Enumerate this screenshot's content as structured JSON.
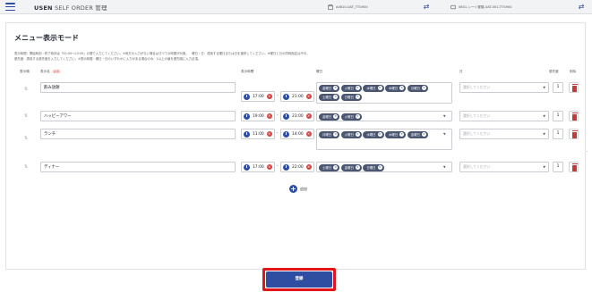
{
  "topbar": {
    "brand": "USEN",
    "brand_sub": "SELF ORDER 管理",
    "store": "A4810-UAT_TTG900",
    "device": "0801-シート冒険-UAT-001-TTG900"
  },
  "page": {
    "title": "メニュー表示モード",
    "note1": "表示時間：開始時刻・終了時刻は「00:00〜23:59」の間で入力してください。※両方の入力がない場合はすべての時間が対象。　曜日・日：適用する曜日または日を選択してください。※曜日と日の同時指定は不可。",
    "note2": "優先度：適用する優先度を入力してください。※表示時間・曜日・日のいずれかに入力がある場合のみ、1以上の値を優先順に入力必須。"
  },
  "columns": {
    "order": "表示順",
    "name": "表示名",
    "required": "必須",
    "time": "表示時間",
    "days": "曜日",
    "date": "日",
    "priority": "優先度",
    "delete": "削除"
  },
  "rows": [
    {
      "name": "飲み放題",
      "start": "17:00",
      "end": "21:00",
      "days": [
        "金曜日",
        "火曜日",
        "水曜日",
        "木曜日",
        "月曜日",
        "土曜日",
        "日曜日"
      ],
      "date_placeholder": "選択してください",
      "priority": "1"
    },
    {
      "name": "ハッピーアワー",
      "start": "19:00",
      "end": "23:00",
      "days": [
        "金曜日",
        "火曜日"
      ],
      "date_placeholder": "選択してください",
      "priority": "1"
    },
    {
      "name": "ランチ",
      "start": "11:00",
      "end": "14:00",
      "days": [
        "月曜日",
        "火曜日",
        "水曜日",
        "木曜日",
        "金曜日"
      ],
      "date_placeholder": "選択してください",
      "priority": "1"
    },
    {
      "name": "ディナー",
      "start": "17:00",
      "end": "22:00",
      "days": [
        "土曜日",
        "金曜日",
        "日曜日"
      ],
      "date_placeholder": "選択してください",
      "priority": "1"
    }
  ],
  "actions": {
    "add": "追加",
    "save": "登録"
  },
  "colors": {
    "primary": "#2f4ea2",
    "chip": "#4a5672",
    "danger": "#d24545",
    "highlight": "#e3151b"
  },
  "icons": {
    "menu": "hamburger-icon",
    "store": "store-icon",
    "swap": "swap-arrows-icon",
    "device": "tablet-icon",
    "clock": "clock-icon",
    "clear": "clear-x-icon",
    "drag": "drag-handle-icon",
    "delete": "trash-icon",
    "add": "plus-circle-icon"
  }
}
